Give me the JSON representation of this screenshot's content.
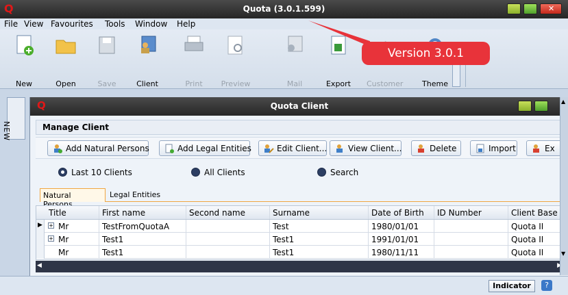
{
  "app": {
    "title": "Quota (3.0.1.599)",
    "logo": "Q"
  },
  "menu": [
    "File",
    "View",
    "Favourites",
    "Tools",
    "Window",
    "Help"
  ],
  "toolbar": [
    {
      "label": "New",
      "icon": "new-document-icon",
      "enabled": true
    },
    {
      "label": "Open",
      "icon": "folder-icon",
      "enabled": true
    },
    {
      "label": "Save",
      "icon": "floppy-icon",
      "enabled": false
    },
    {
      "label": "Client",
      "icon": "client-icon",
      "enabled": true
    },
    {
      "label": "Print",
      "icon": "printer-icon",
      "enabled": false
    },
    {
      "label": "Preview",
      "icon": "preview-icon",
      "enabled": false
    },
    {
      "label": "Mail",
      "icon": "mail-icon",
      "enabled": false
    },
    {
      "label": "Export",
      "icon": "export-icon",
      "enabled": true
    },
    {
      "label": "Customer",
      "icon": "customer-icon",
      "enabled": false
    },
    {
      "label": "Theme",
      "icon": "theme-icon",
      "enabled": true
    }
  ],
  "callout": "Version 3.0.1",
  "side_tab": "NEW",
  "child": {
    "title": "Quota Client",
    "logo": "Q",
    "section": "Manage Client",
    "actions": [
      {
        "label": "Add Natural Persons",
        "icon": "add-person-icon"
      },
      {
        "label": "Add Legal Entities",
        "icon": "add-entity-icon"
      },
      {
        "label": "Edit Client...",
        "icon": "edit-client-icon"
      },
      {
        "label": "View Client...",
        "icon": "view-client-icon"
      },
      {
        "label": "Delete",
        "icon": "delete-icon"
      },
      {
        "label": "Import",
        "icon": "import-icon"
      },
      {
        "label": "Ex",
        "icon": "export-client-icon"
      }
    ],
    "radios": [
      {
        "label": "Last 10 Clients",
        "selected": true
      },
      {
        "label": "All Clients",
        "selected": false
      },
      {
        "label": "Search",
        "selected": false
      }
    ],
    "tabs": [
      "Natural Persons",
      "Legal Entities"
    ],
    "columns": [
      "Title",
      "First name",
      "Second name",
      "Surname",
      "Date of Birth",
      "ID Number",
      "Client Base"
    ],
    "rows": [
      {
        "expander": true,
        "current": true,
        "cells": [
          "Mr",
          "TestFromQuotaA",
          "",
          "Test",
          "1980/01/01",
          "",
          "Quota II"
        ]
      },
      {
        "expander": true,
        "current": false,
        "cells": [
          "Mr",
          "Test1",
          "",
          "Test1",
          "1991/01/01",
          "",
          "Quota II"
        ]
      },
      {
        "expander": false,
        "current": false,
        "cells": [
          "Mr",
          "Test1",
          "",
          "Test1",
          "1980/11/11",
          "",
          "Quota II"
        ]
      }
    ]
  },
  "status": {
    "indicator": "Indicator"
  },
  "colors": {
    "accent": "#f0a640",
    "titlebar": "#2a2a2a",
    "callout": "#e8333a"
  }
}
